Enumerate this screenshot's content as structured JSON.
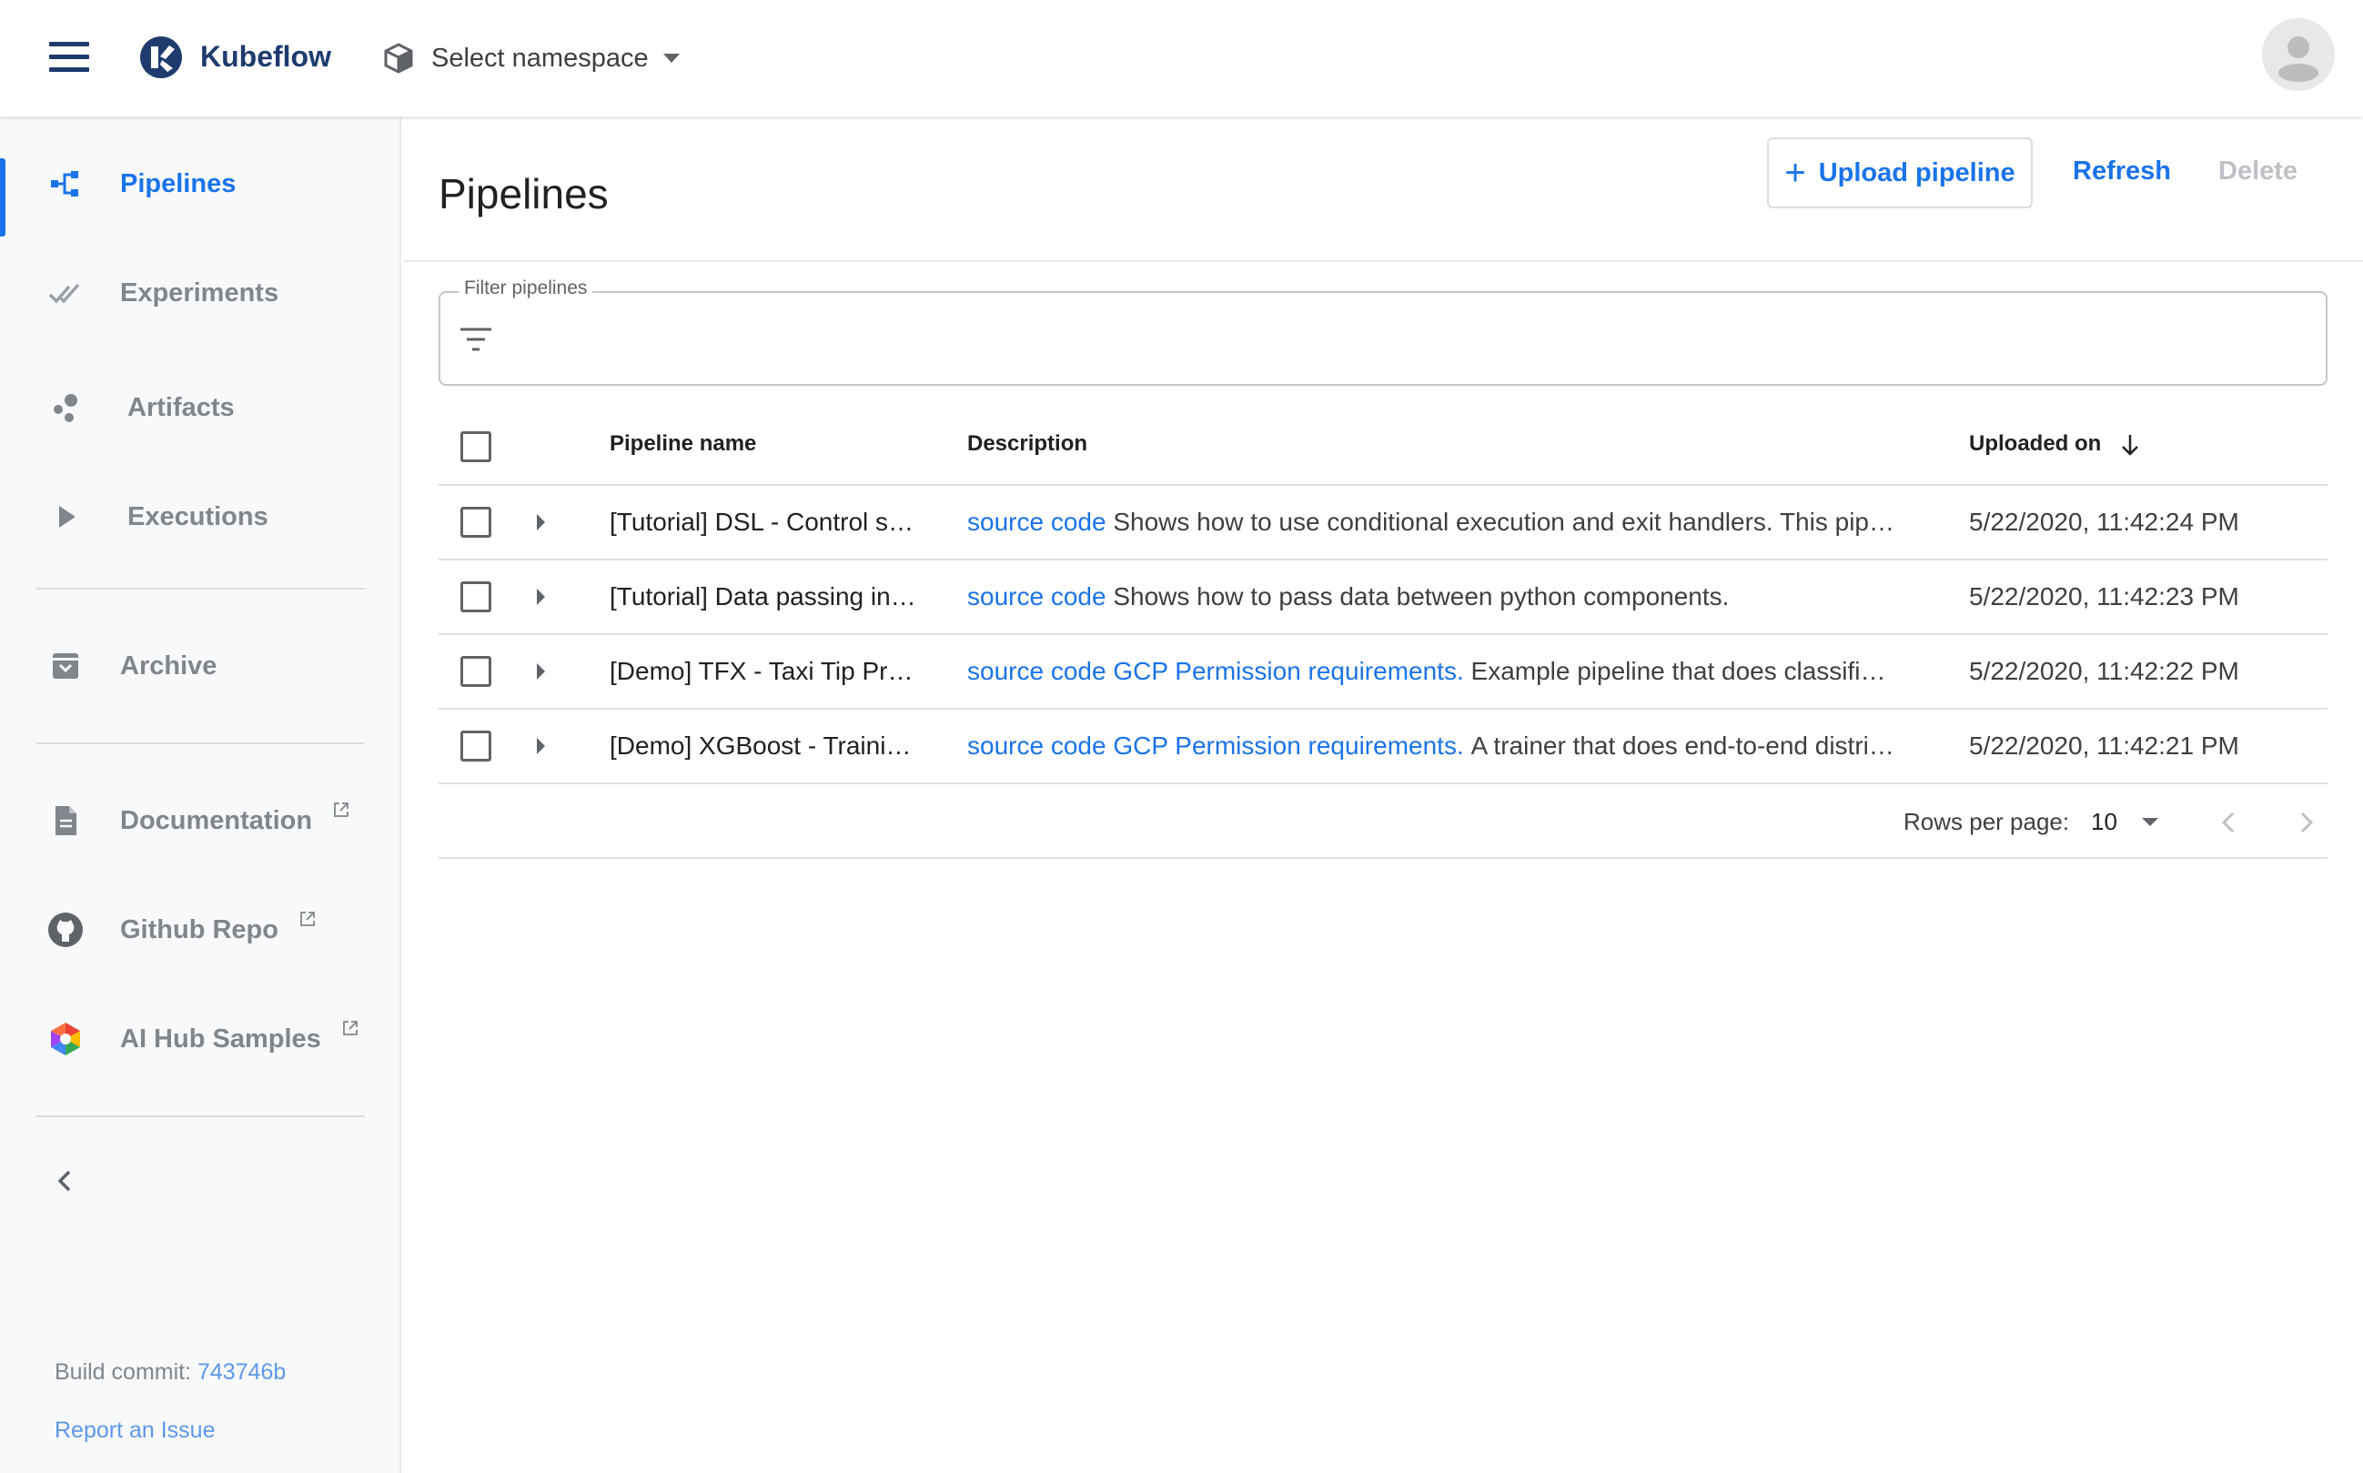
{
  "app": {
    "title": "Kubeflow",
    "namespace_label": "Select namespace"
  },
  "sidebar": {
    "items": [
      {
        "label": "Pipelines",
        "icon": "pipelines-icon",
        "active": true
      },
      {
        "label": "Experiments",
        "icon": "experiments-icon"
      },
      {
        "label": "Artifacts",
        "icon": "artifacts-icon"
      },
      {
        "label": "Executions",
        "icon": "executions-icon"
      },
      {
        "label": "Archive",
        "icon": "archive-icon"
      },
      {
        "label": "Documentation",
        "icon": "document-icon",
        "external": true
      },
      {
        "label": "Github Repo",
        "icon": "github-icon",
        "external": true
      },
      {
        "label": "AI Hub Samples",
        "icon": "ai-hub-icon",
        "external": true
      }
    ],
    "build_commit_label": "Build commit:",
    "build_commit": "743746b",
    "report_issue": "Report an Issue"
  },
  "main": {
    "title": "Pipelines",
    "actions": {
      "upload": "Upload pipeline",
      "refresh": "Refresh",
      "delete": "Delete"
    },
    "filter": {
      "label": "Filter pipelines",
      "value": ""
    },
    "table": {
      "columns": [
        "Pipeline name",
        "Description",
        "Uploaded on"
      ],
      "sort_column": "Uploaded on",
      "sort_direction": "descending",
      "rows": [
        {
          "name": "[Tutorial] DSL - Control structures",
          "name_display": "[Tutorial] DSL - Control s…",
          "links": [
            "source code"
          ],
          "description": "Shows how to use conditional execution and exit handlers. This pip…",
          "uploaded": "5/22/2020, 11:42:24 PM"
        },
        {
          "name": "[Tutorial] Data passing in python components",
          "name_display": "[Tutorial] Data passing in…",
          "links": [
            "source code"
          ],
          "description": "Shows how to pass data between python components.",
          "uploaded": "5/22/2020, 11:42:23 PM"
        },
        {
          "name": "[Demo] TFX - Taxi Tip Prediction",
          "name_display": "[Demo] TFX - Taxi Tip Pr…",
          "links": [
            "source code",
            "GCP Permission requirements"
          ],
          "description": "Example pipeline that does classifi…",
          "uploaded": "5/22/2020, 11:42:22 PM"
        },
        {
          "name": "[Demo] XGBoost - Training",
          "name_display": "[Demo] XGBoost - Traini…",
          "links": [
            "source code",
            "GCP Permission requirements"
          ],
          "description": "A trainer that does end-to-end distri…",
          "uploaded": "5/22/2020, 11:42:21 PM"
        }
      ]
    },
    "pagination": {
      "rows_per_page_label": "Rows per page:",
      "rows_per_page": "10"
    }
  },
  "colors": {
    "accent": "#1a73e8",
    "brand_dark": "#1f3b6e",
    "muted": "#80868b",
    "sidebar_bg": "#f8f9fa"
  }
}
